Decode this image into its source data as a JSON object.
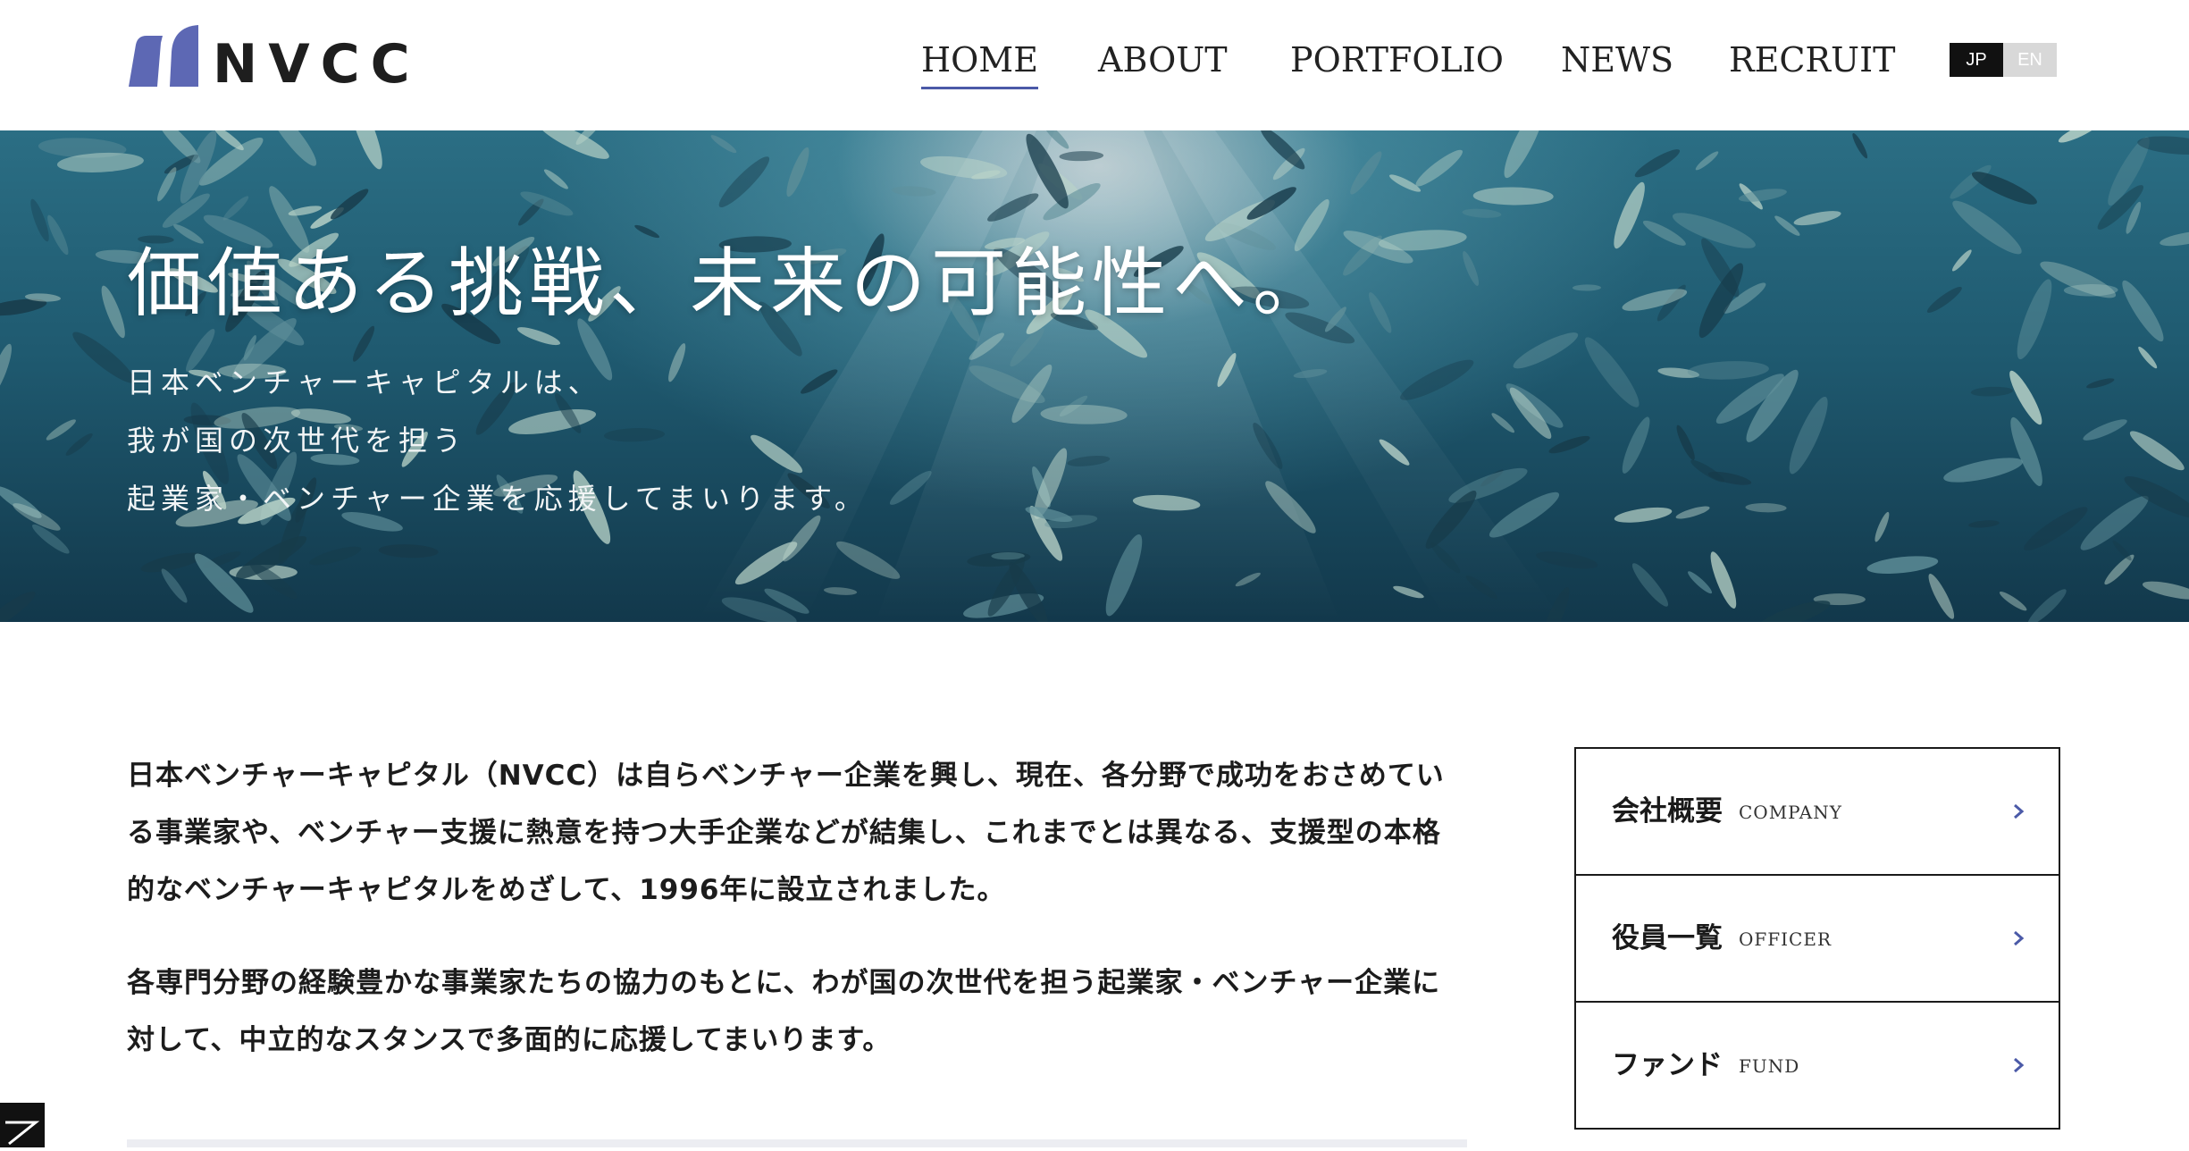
{
  "header": {
    "logo_text": "NVCC",
    "nav": [
      {
        "label": "HOME",
        "active": true
      },
      {
        "label": "ABOUT",
        "active": false
      },
      {
        "label": "PORTFOLIO",
        "active": false
      },
      {
        "label": "NEWS",
        "active": false
      },
      {
        "label": "RECRUIT",
        "active": false
      }
    ],
    "lang": {
      "jp": "JP",
      "en": "EN",
      "selected": "JP"
    }
  },
  "hero": {
    "title": "価値ある挑戦、未来の可能性へ。",
    "subtitle_lines": [
      "日本ベンチャーキャピタルは、",
      "我が国の次世代を担う",
      "起業家・ベンチャー企業を応援してまいります。"
    ]
  },
  "intro": {
    "paragraphs": [
      "日本ベンチャーキャピタル（NVCC）は自らベンチャー企業を興し、現在、各分野で成功をおさめている事業家や、ベンチャー支援に熱意を持つ大手企業などが結集し、これまでとは異なる、支援型の本格的なベンチャーキャピタルをめざして、1996年に設立されました。",
      "各専門分野の経験豊かな事業家たちの協力のもとに、わが国の次世代を担う起業家・ベンチャー企業に対して、中立的なスタンスで多面的に応援してまいります。"
    ]
  },
  "sidebar": {
    "items": [
      {
        "ja": "会社概要",
        "en": "COMPANY",
        "icon": "chevron-right-icon"
      },
      {
        "ja": "役員一覧",
        "en": "OFFICER",
        "icon": "chevron-right-icon"
      },
      {
        "ja": "ファンド",
        "en": "FUND",
        "icon": "chevron-right-icon"
      }
    ]
  },
  "colors": {
    "accent": "#4b5aa8",
    "logo": "#5d68b4",
    "text": "#1a1a1a",
    "lang_selected_bg": "#111111",
    "lang_unselected_bg": "#d8d8d8",
    "hero_water": "#1f5a70"
  }
}
